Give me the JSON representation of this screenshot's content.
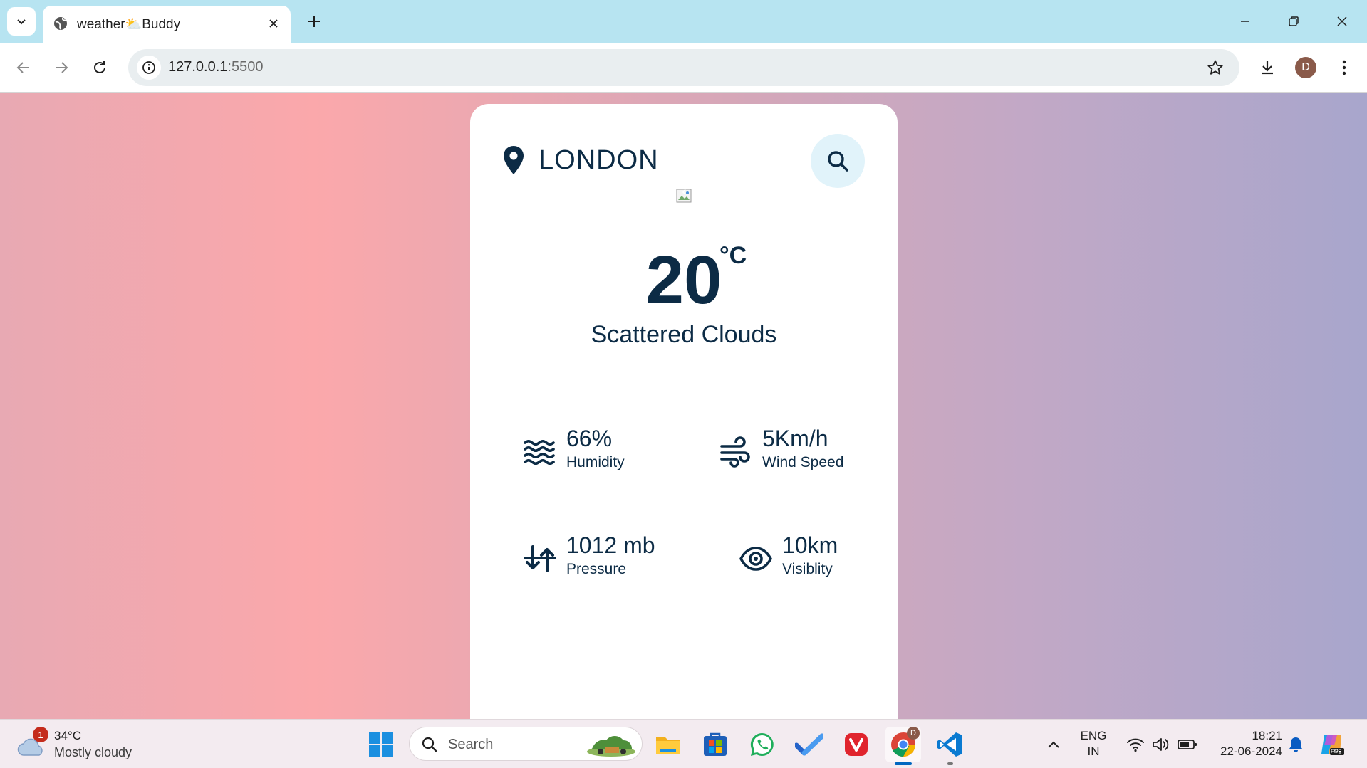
{
  "browser": {
    "tab_title": "weather⛅Buddy",
    "url_host": "127.0.0.1",
    "url_port": ":5500",
    "profile_initial": "D"
  },
  "weather_card": {
    "city": "LONDON",
    "temperature": "20",
    "unit": "°C",
    "condition": "Scattered Clouds",
    "stats": [
      {
        "icon": "waves-icon",
        "value": "66%",
        "label": "Humidity"
      },
      {
        "icon": "wind-icon",
        "value": "5Km/h",
        "label": "Wind Speed"
      },
      {
        "icon": "pressure-icon",
        "value": "1012 mb",
        "label": "Pressure"
      },
      {
        "icon": "eye-icon",
        "value": "10km",
        "label": "Visiblity"
      }
    ]
  },
  "taskbar": {
    "weather_badge": "1",
    "weather_temp": "34°C",
    "weather_condition": "Mostly cloudy",
    "search_label": "Search",
    "language_line1": "ENG",
    "language_line2": "IN",
    "time": "18:21",
    "date": "22-06-2024",
    "chrome_profile": "D"
  },
  "colors": {
    "text_primary": "#0c2b45",
    "search_button_bg": "#e1f3fa",
    "tab_strip": "#b7e4f1"
  }
}
